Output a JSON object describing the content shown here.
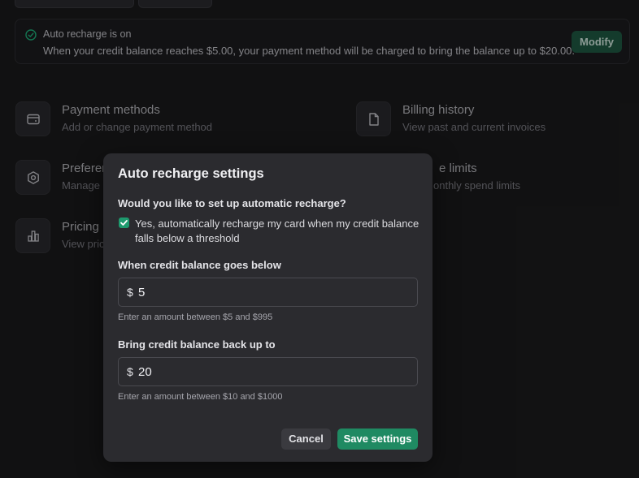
{
  "banner": {
    "icon": "check-circle-icon",
    "title": "Auto recharge is on",
    "description": "When your credit balance reaches $5.00, your payment method will be charged to bring the balance up to $20.00.",
    "modify_label": "Modify"
  },
  "tiles": [
    {
      "icon": "credit-card-icon",
      "title": "Payment methods",
      "subtitle": "Add or change payment method"
    },
    {
      "icon": "document-icon",
      "title": "Billing history",
      "subtitle": "View past and current invoices"
    },
    {
      "icon": "gear-icon",
      "title": "Preferen",
      "subtitle": "Manage b"
    },
    {
      "icon": "limits-icon",
      "title": "e limits",
      "subtitle": "onthly spend limits"
    },
    {
      "icon": "bar-chart-icon",
      "title": "Pricing",
      "subtitle": "View pric"
    }
  ],
  "modal": {
    "title": "Auto recharge settings",
    "question": "Would you like to set up automatic recharge?",
    "checkbox_label": "Yes, automatically recharge my card when my credit balance falls below a threshold",
    "checkbox_checked": true,
    "threshold": {
      "label": "When credit balance goes below",
      "currency": "$",
      "value": "5",
      "hint": "Enter an amount between $5 and $995"
    },
    "target": {
      "label": "Bring credit balance back up to",
      "currency": "$",
      "value": "20",
      "hint": "Enter an amount between $10 and $1000"
    },
    "cancel_label": "Cancel",
    "save_label": "Save settings"
  },
  "colors": {
    "accent": "#1f8a62",
    "background": "#1b1b1d",
    "modal": "#2b2b2f"
  }
}
